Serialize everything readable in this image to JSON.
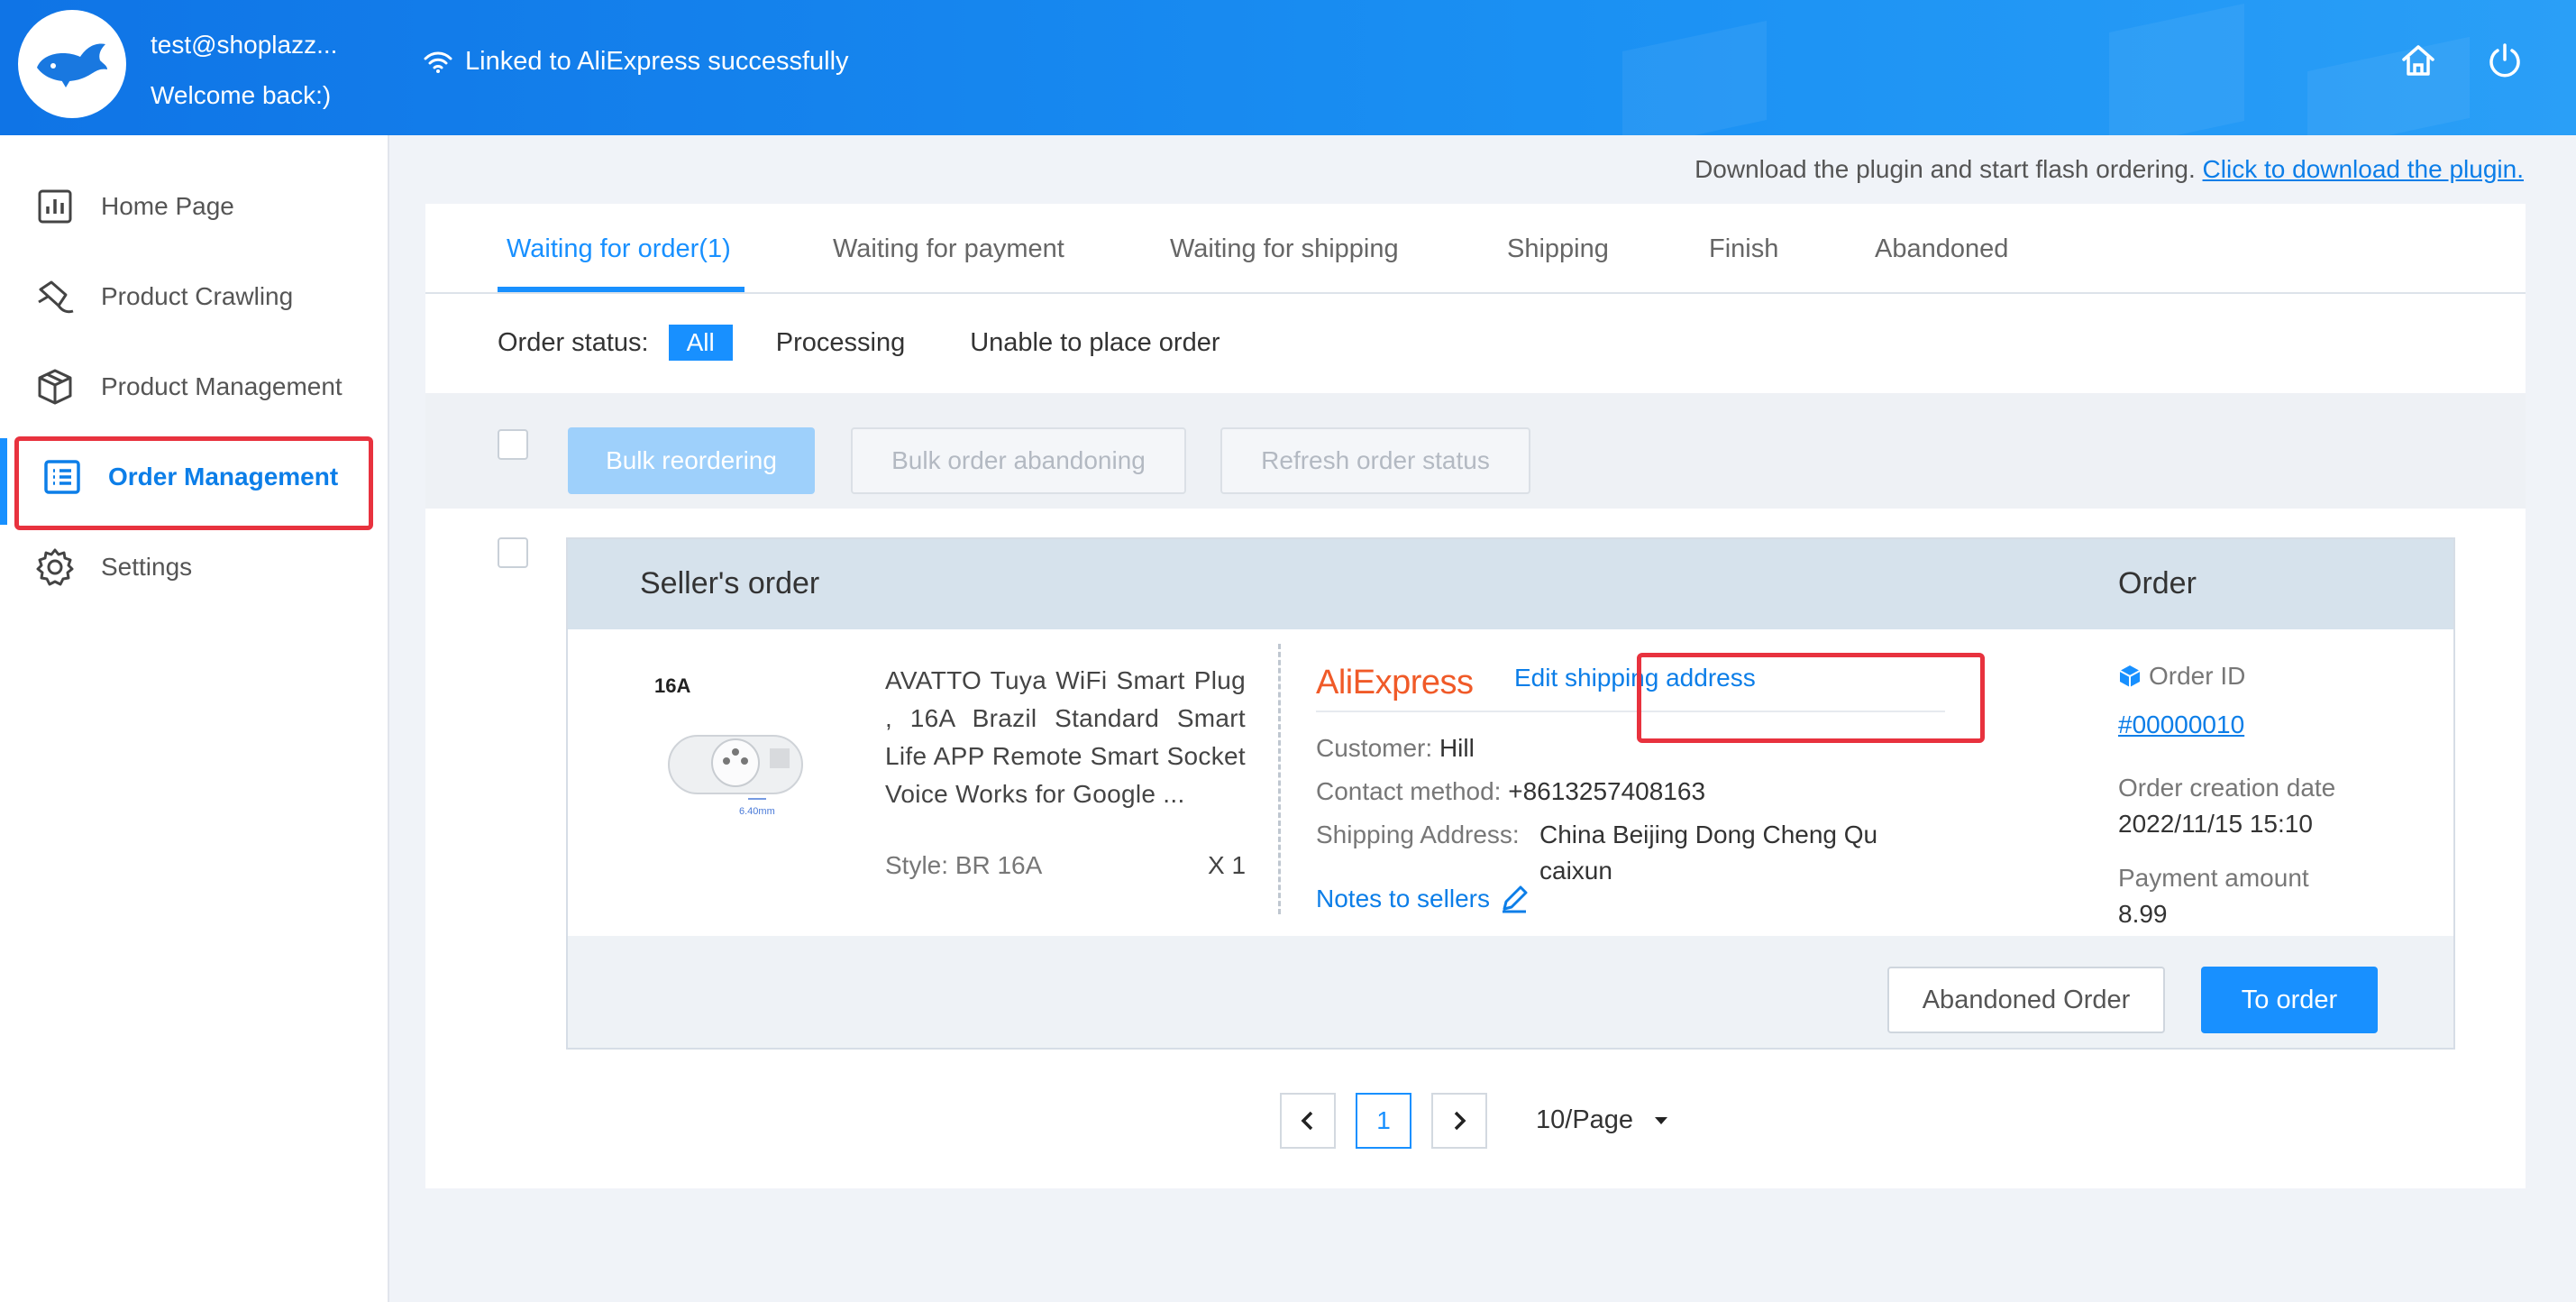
{
  "header": {
    "user_email": "test@shoplazz...",
    "welcome": "Welcome back:)",
    "link_status": "Linked to AliExpress successfully",
    "icons": [
      "wifi-icon",
      "home-icon",
      "power-icon"
    ]
  },
  "sidebar": {
    "items": [
      {
        "label": "Home Page",
        "icon": "chart-icon"
      },
      {
        "label": "Product Crawling",
        "icon": "crawl-icon"
      },
      {
        "label": "Product Management",
        "icon": "box-icon"
      },
      {
        "label": "Order Management",
        "icon": "list-icon",
        "active": true
      },
      {
        "label": "Settings",
        "icon": "gear-icon"
      }
    ]
  },
  "download": {
    "text": "Download the plugin and start flash ordering.",
    "link": "Click to download the plugin."
  },
  "tabs": [
    {
      "label": "Waiting for order(1)",
      "active": true
    },
    {
      "label": "Waiting for payment"
    },
    {
      "label": "Waiting for shipping"
    },
    {
      "label": "Shipping"
    },
    {
      "label": "Finish"
    },
    {
      "label": "Abandoned"
    }
  ],
  "status_filter": {
    "label": "Order status:",
    "options": [
      "All",
      "Processing",
      "Unable to place order"
    ],
    "selected": "All"
  },
  "bulk_actions": {
    "reorder": "Bulk reordering",
    "abandon": "Bulk order abandoning",
    "refresh": "Refresh order status"
  },
  "order": {
    "seller_header": "Seller's order",
    "order_header": "Order",
    "product": {
      "badge": "16A",
      "image_caption": "6.40mm",
      "title": "AVATTO Tuya WiFi Smart Plug , 16A Brazil Standard Smart Life APP Remote Smart Socket Voice Works for Google ...",
      "style_label": "Style:",
      "style_value": "BR 16A",
      "quantity": "X 1"
    },
    "supplier": {
      "logo": "AliExpress",
      "edit_shipping": "Edit shipping address",
      "customer_label": "Customer:",
      "customer_value": "Hill",
      "contact_label": "Contact method:",
      "contact_value": "+8613257408163",
      "address_label": "Shipping Address:",
      "address_line1": "China Beijing Dong Cheng Qu",
      "address_line2": "caixun",
      "notes": "Notes to sellers"
    },
    "details": {
      "id_label": "Order ID",
      "id_value": "#00000010",
      "date_label": "Order creation date",
      "date_value": "2022/11/15 15:10",
      "amount_label": "Payment amount",
      "amount_value": "8.99"
    },
    "actions": {
      "abandon": "Abandoned Order",
      "order": "To order"
    }
  },
  "pagination": {
    "current": "1",
    "page_size": "10/Page"
  },
  "colors": {
    "primary": "#1890ff",
    "header_start": "#0f74e6",
    "highlight_red": "#e8323e",
    "aliexpress": "#f05a28"
  }
}
